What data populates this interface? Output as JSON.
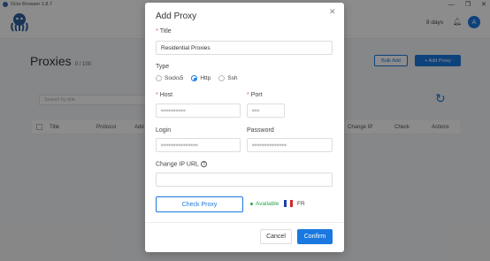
{
  "window": {
    "title": "Octo Browser 1.8.7",
    "controls": {
      "minimize": "—",
      "restore": "❐",
      "close": "✕"
    }
  },
  "header": {
    "days": "8 days",
    "avatar_letter": "A"
  },
  "page": {
    "title": "Proxies",
    "count": "0 / 100",
    "bulk_add": "Bulk Add",
    "add_proxy": "+ Add Proxy",
    "search_placeholder": "Search by title",
    "table_columns": [
      "Title",
      "Protocol",
      "Add",
      "Change IP",
      "Check",
      "Actions"
    ]
  },
  "modal": {
    "title": "Add Proxy",
    "title_label": "Title",
    "title_value": "Residential Proxies",
    "type_label": "Type",
    "types": [
      "Socks5",
      "Http",
      "Ssh"
    ],
    "selected_type": "Http",
    "host_label": "Host",
    "host_value": "▪▪▪▪▪▪▪▪▪▪",
    "port_label": "Port",
    "port_value": "▪▪▪",
    "login_label": "Login",
    "login_value": "▪▪▪▪▪▪▪▪▪▪▪▪▪▪▪",
    "password_label": "Password",
    "password_value": "▪▪▪▪▪▪▪▪▪▪▪▪▪▪",
    "change_ip_label": "Change IP URL",
    "change_ip_value": "",
    "check_button": "Check Proxy",
    "status": "Available",
    "country": "FR",
    "cancel": "Cancel",
    "confirm": "Confirm"
  },
  "colors": {
    "accent": "#1a78e0",
    "success": "#2aa54a",
    "flag": [
      "#1f3fae",
      "#ffffff",
      "#d8262b"
    ]
  }
}
